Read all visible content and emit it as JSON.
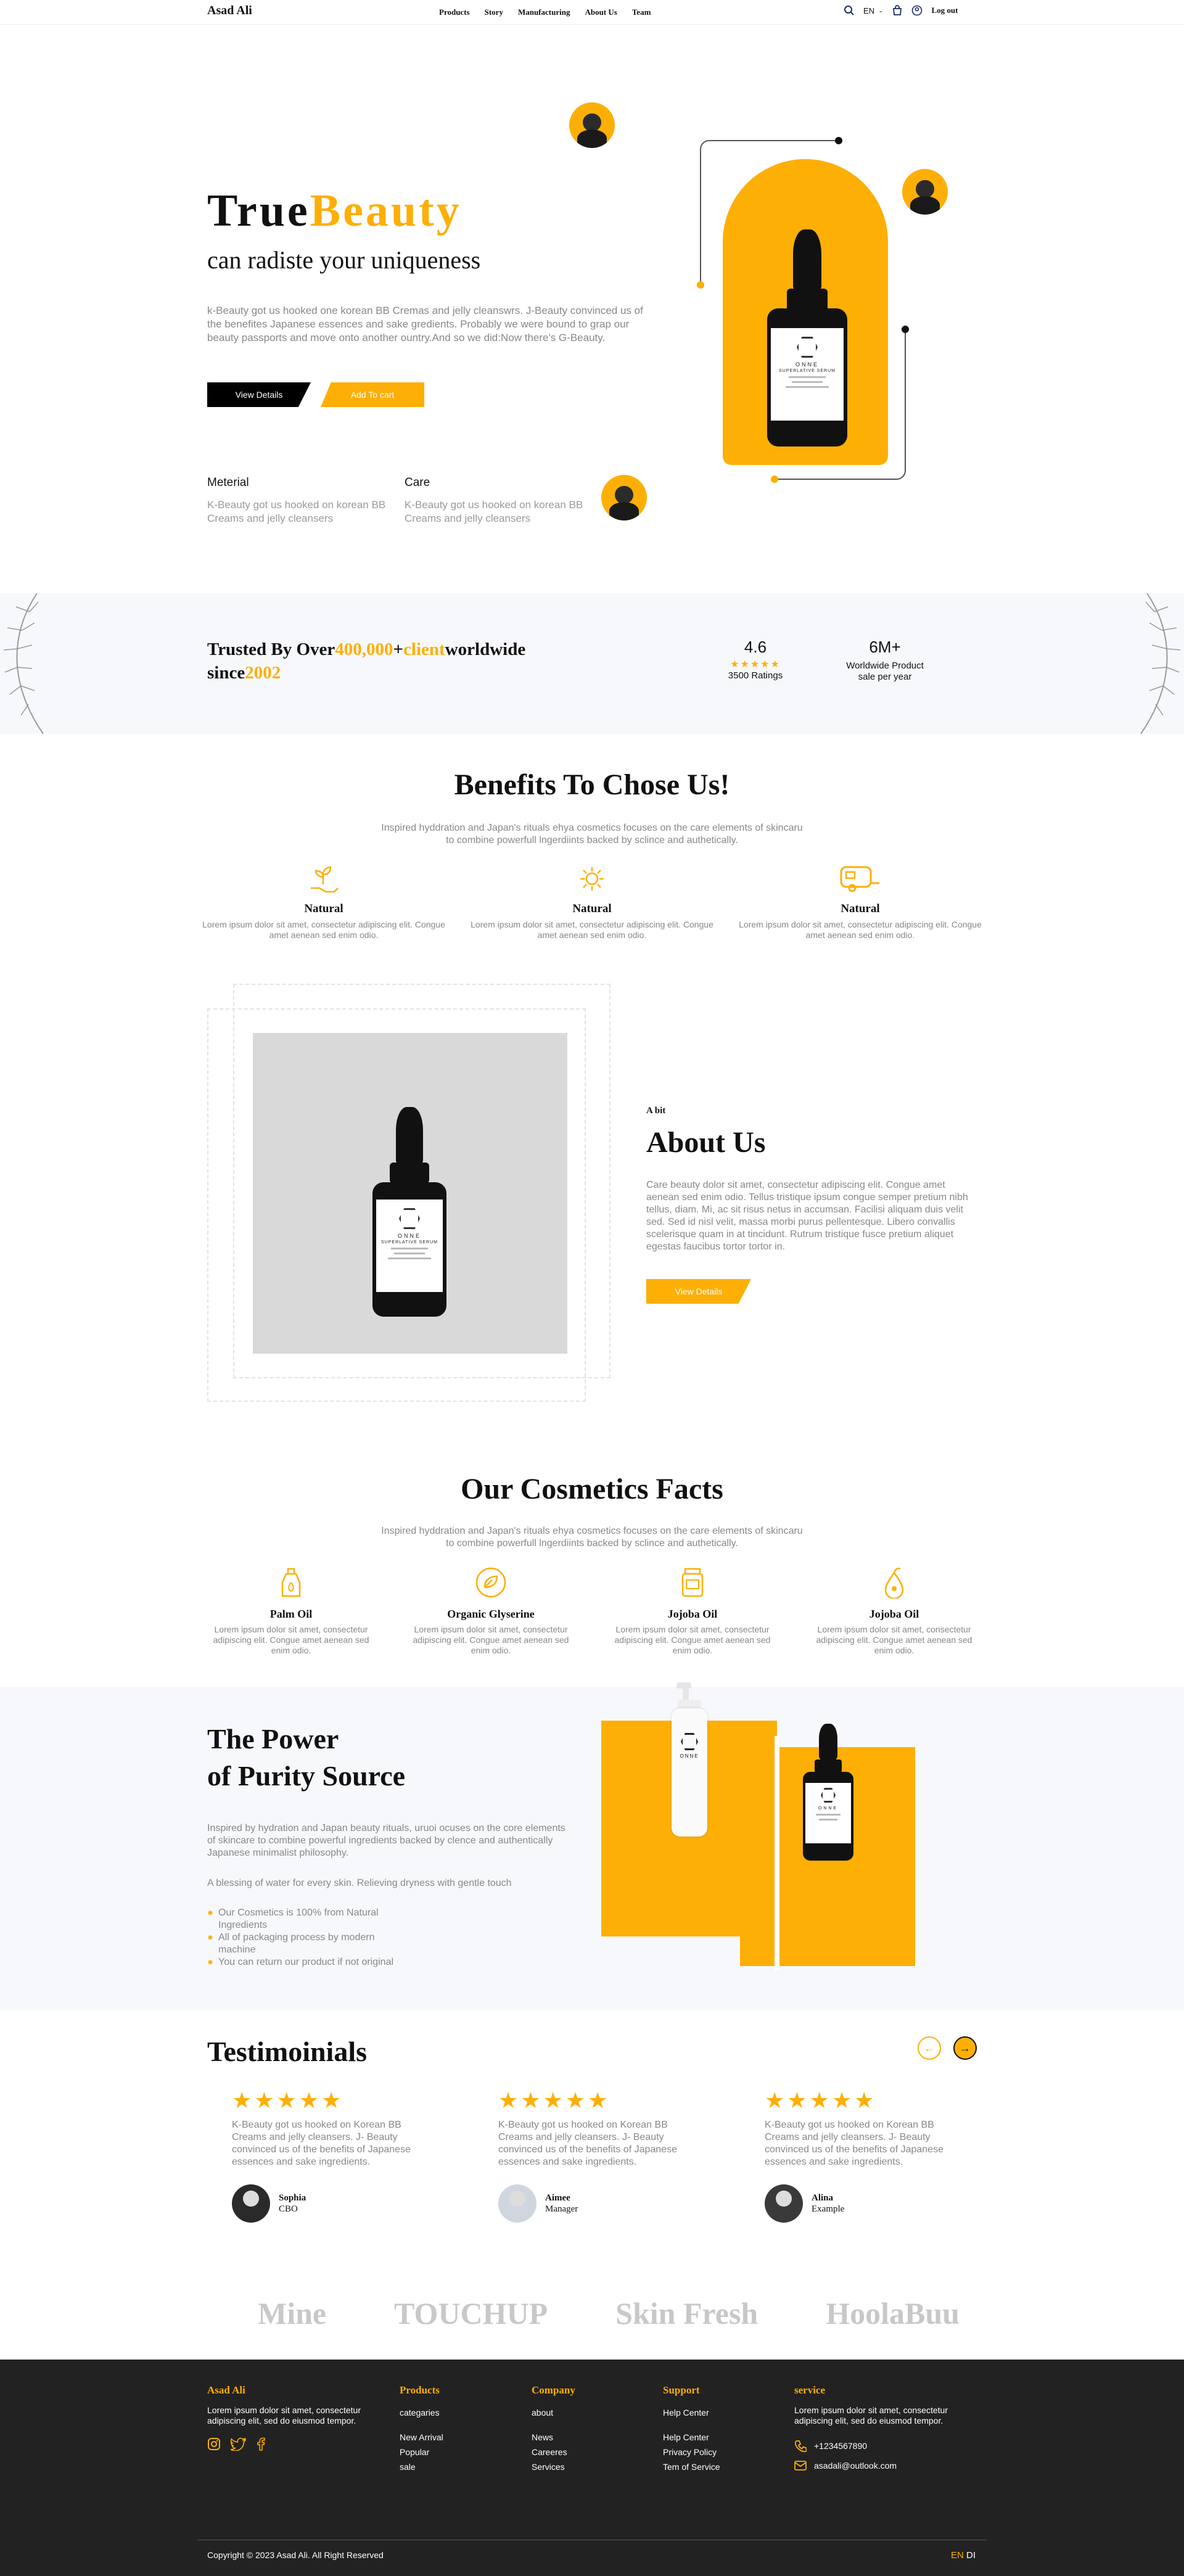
{
  "header": {
    "logo": "Asad Ali",
    "menu": [
      "Products",
      "Story",
      "Manufacturing",
      "About Us",
      "Team"
    ],
    "language": "EN",
    "logout": "Log out"
  },
  "hero": {
    "title_black": "True",
    "title_yellow": "Beauty",
    "subtitle": "can radiste your uniqueness",
    "paragraph": "k-Beauty got us hooked one korean BB Cremas and jelly cleanswrs. J-Beauty convinced us of the benefites Japanese essences and sake gredients. Probably we were bound to grap our beauty passports and move onto another ountry.And so we did:Now there's G-Beauty.",
    "btn_details": "View Details",
    "btn_cart": "Add To cart",
    "features": [
      {
        "title": "Meterial",
        "text": "K-Beauty got us hooked on korean BB Creams and jelly cleansers"
      },
      {
        "title": "Care",
        "text": "K-Beauty got us hooked on korean BB Creams and jelly cleansers"
      }
    ],
    "bottle": {
      "brand": "ONNE",
      "name": "SUPERLATIVE SERUM"
    }
  },
  "trusted": {
    "pre": "Trusted By Over",
    "num": "400,000",
    "plus": "+",
    "client": "client",
    "post": "worldwide",
    "since": "since",
    "year": "2002",
    "stats": [
      {
        "value": "4.6",
        "stars": "★★★★★",
        "label": "3500 Ratings"
      },
      {
        "value": "6M+",
        "label": "Worldwide Product",
        "label2": "sale per year"
      }
    ]
  },
  "benefits": {
    "title": "Benefits To Chose Us!",
    "text": "Inspired hyddration and Japan's rituals ehya cosmetics focuses on the care elements of skincaru to combine powerfull lngerdiints backed by sclince and authetically.",
    "items": [
      {
        "title": "Natural",
        "text": "Lorem ipsum dolor sit amet, consectetur adipiscing elit. Congue amet aenean sed enim odio."
      },
      {
        "title": "Natural",
        "text": "Lorem ipsum dolor sit amet, consectetur adipiscing elit. Congue amet aenean sed enim odio."
      },
      {
        "title": "Natural",
        "text": "Lorem ipsum dolor sit amet, consectetur adipiscing elit. Congue amet aenean sed enim odio."
      }
    ]
  },
  "about": {
    "kicker": "A bit",
    "title": "About Us",
    "text": "Care beauty dolor sit amet, consectetur adipiscing elit. Congue amet aenean sed enim odio. Tellus tristique ipsum congue semper pretium nibh tellus, diam. Mi, ac sit risus netus in accumsan. Facilisi aliquam duis velit sed. Sed id nisl velit, massa morbi purus pellentesque. Libero convallis scelerisque quam in at tincidunt. Rutrum tristique fusce pretium aliquet egestas faucibus tortor tortor in.",
    "button": "View Details"
  },
  "facts": {
    "title": "Our Cosmetics Facts",
    "text": "Inspired hyddration and Japan's rituals ehya cosmetics focuses on the care elements of skincaru to combine powerfull lngerdiints backed by sclince and authetically.",
    "items": [
      {
        "title": "Palm Oil",
        "text": "Lorem ipsum dolor sit amet, consectetur adipiscing elit. Congue amet aenean sed enim odio."
      },
      {
        "title": "Organic Glyserine",
        "text": "Lorem ipsum dolor sit amet, consectetur adipiscing elit. Congue amet aenean sed enim odio."
      },
      {
        "title": "Jojoba Oil",
        "text": "Lorem ipsum dolor sit amet, consectetur adipiscing elit. Congue amet aenean sed enim odio."
      },
      {
        "title": "Jojoba Oil",
        "text": "Lorem ipsum dolor sit amet, consectetur adipiscing elit. Congue amet aenean sed enim odio."
      }
    ]
  },
  "power": {
    "title1": "The Power",
    "title2": "of Purity Source",
    "text": "Inspired by hydration and Japan beauty rituals, uruoi ocuses on the core elements of skincare to combine powerful ingredients backed by clence and authentically Japanese minimalist philosophy.",
    "text2": "A blessing of water for every skin. Relieving dryness with gentle touch",
    "bullets": [
      "Our Cosmetics is 100% from Natural Ingredients",
      "All of packaging process by modern machine",
      "You can return our product if not original"
    ]
  },
  "testimonials": {
    "title": "Testimoinials",
    "items": [
      {
        "stars": "★★★★★",
        "text": "K-Beauty got us hooked on Korean BB Creams and jelly cleansers. J- Beauty convinced us of the benefits of Japanese essences and sake ingredients.",
        "name": "Sophia",
        "role": "CBO"
      },
      {
        "stars": "★★★★★",
        "text": "K-Beauty got us hooked on Korean BB Creams and jelly cleansers. J- Beauty convinced us of the benefits of Japanese essences and sake ingredients.",
        "name": "Aimee",
        "role": "Manager"
      },
      {
        "stars": "★★★★★",
        "text": "K-Beauty got us hooked on Korean BB Creams and jelly cleansers. J- Beauty convinced us of the benefits of Japanese essences and sake ingredients.",
        "name": "Alina",
        "role": "Example"
      }
    ]
  },
  "brands": [
    "Mine",
    "TOUCHUP",
    "Skin Fresh",
    "HoolaBuu"
  ],
  "footer": {
    "logo": "Asad Ali",
    "about": "Lorem ipsum dolor sit amet, consectetur adipiscing elit, sed do eiusmod tempor.",
    "products_title": "Products",
    "products": [
      "categaries",
      "New Arrival",
      "Popular",
      "sale"
    ],
    "company_title": "Company",
    "company": [
      "about",
      "News",
      "Careeres",
      "Services"
    ],
    "support_title": "Support",
    "support": [
      "Help Center",
      "Help Center",
      "Privacy Policy",
      "Tem of Service"
    ],
    "service_title": "service",
    "service_text": "Lorem ipsum dolor sit amet, consectetur adipiscing elit, sed do eiusmod tempor.",
    "phone": "+1234567890",
    "email": "asadali@outlook.com",
    "copyright": "Copyright © 2023 Asad Ali. All Right Reserved",
    "lang_en": "EN",
    "lang_di": "DI"
  }
}
